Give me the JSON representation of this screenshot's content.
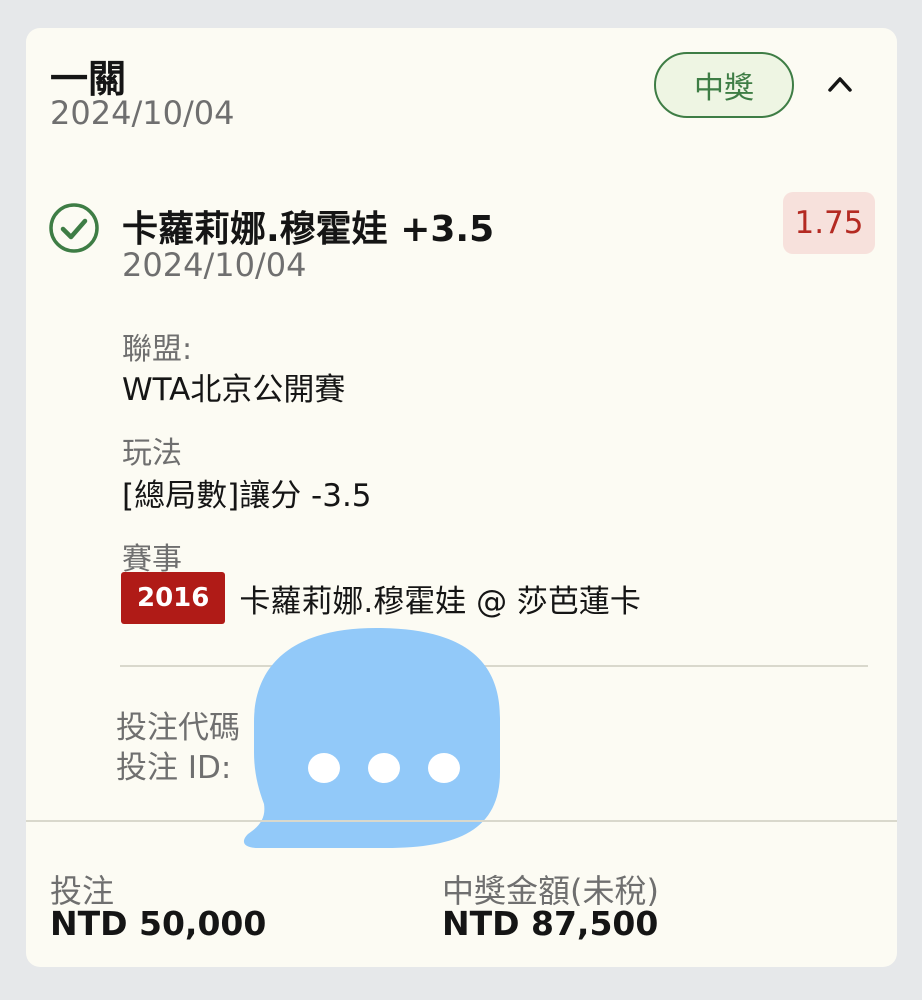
{
  "bet": {
    "type": "一關",
    "date": "2024/10/04",
    "status": "中獎",
    "accent_green": "#3e7d45"
  },
  "selection": {
    "title": "卡蘿莉娜.穆霍娃 +3.5",
    "date": "2024/10/04",
    "odds": "1.75",
    "odds_color": "#b42a22",
    "status_icon": "check-circle-icon"
  },
  "details": {
    "league_label": "聯盟:",
    "league_value": "WTA北京公開賽",
    "play_label": "玩法",
    "play_value": "[總局數]讓分 -3.5",
    "event_label": "賽事",
    "event_number": "2016",
    "event_name": "卡蘿莉娜.穆霍娃 @ 莎芭蓮卡"
  },
  "ids": {
    "code_label": "投注代碼",
    "id_label": "投注 ID:"
  },
  "overlay": {
    "icon": "chat-bubble-icon",
    "color": "#92c9f9"
  },
  "summary": {
    "stake_label": "投注",
    "stake_value": "NTD 50,000",
    "payout_label": "中獎金額(未稅)",
    "payout_value": "NTD 87,500"
  }
}
